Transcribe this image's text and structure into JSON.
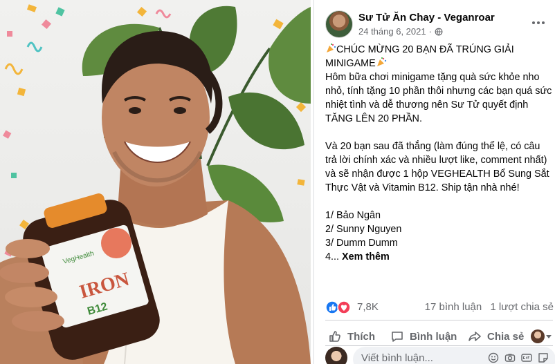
{
  "post": {
    "author": "Sư Tử Ăn Chay - Veganroar",
    "date": "24 tháng 6, 2021",
    "dot": "·",
    "body": {
      "headline_1": "CHÚC MỪNG 20 BẠN ĐÃ TRÚNG GIẢI",
      "headline_2": "MINIGAME",
      "para1": "Hôm bữa chơi minigame tặng quà sức khỏe nho nhỏ, tính tặng 10 phần thôi nhưng các bạn quá sức nhiệt tình và dễ thương nên Sư Tử quyết định TĂNG LÊN 20 PHẦN.",
      "para2": "Và 20 bạn sau đã thắng (làm đúng thể lệ, có câu trả lời chính xác và nhiều lượt like, comment nhất) và sẽ nhận được 1 hộp VEGHEALTH Bổ Sung Sắt Thực Vật và Vitamin B12. Ship tận nhà nhé!",
      "list": [
        "1/ Bảo Ngân",
        "2/ Sunny Nguyen",
        "3/ Dumm Dumm"
      ],
      "list_tail": "4...",
      "see_more": "Xem thêm"
    },
    "reactions": {
      "count": "7,8K",
      "comments": "17 bình luận",
      "shares": "1 lượt chia sẻ"
    },
    "actions": {
      "like": "Thích",
      "comment": "Bình luận",
      "share": "Chia sẻ"
    },
    "comment_box": {
      "placeholder": "Viết bình luận..."
    }
  },
  "photo": {
    "bottle": {
      "brand": "VegHealth",
      "product": "IRON",
      "sub": "B12"
    }
  },
  "colors": {
    "facebook_blue": "#1877f2",
    "love_red": "#f33e58",
    "muted_text": "#65676b"
  },
  "icons": [
    "globe-icon",
    "more-icon",
    "party-popper-icon",
    "like-reaction-icon",
    "love-reaction-icon",
    "like-icon",
    "comment-icon",
    "share-icon",
    "emoji-icon",
    "camera-icon",
    "gif-icon",
    "sticker-icon"
  ]
}
